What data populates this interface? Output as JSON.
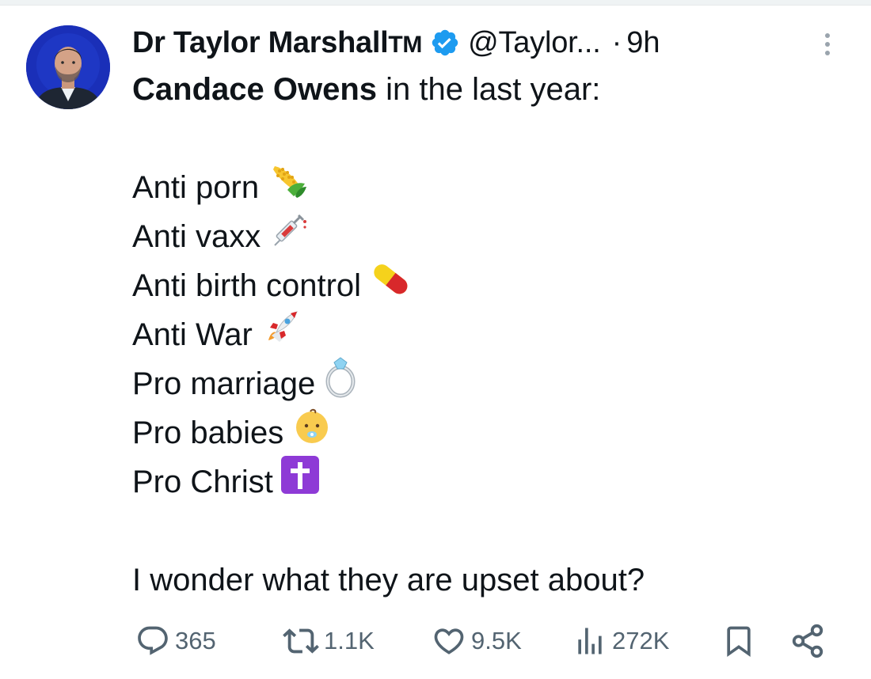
{
  "tweet": {
    "author": {
      "name": "Dr Taylor Marshall",
      "name_suffix": "TM",
      "handle": "@Taylor...",
      "verified_icon": "verified-badge-icon",
      "avatar_bg": "#1a2fb8"
    },
    "separator": "·",
    "time": "9h",
    "more_icon": "more-vertical-icon",
    "text": {
      "mention_bold": "Candace Owens",
      "first_line_rest": " in the last year:",
      "items": [
        {
          "label": "Anti porn",
          "emoji": "corn-icon"
        },
        {
          "label": "Anti vaxx",
          "emoji": "syringe-icon"
        },
        {
          "label": "Anti birth control",
          "emoji": "pill-icon"
        },
        {
          "label": "Anti War",
          "emoji": "rocket-icon"
        },
        {
          "label": "Pro marriage",
          "emoji": "ring-icon"
        },
        {
          "label": "Pro babies",
          "emoji": "baby-icon"
        },
        {
          "label": "Pro Christ",
          "emoji": "latin-cross-icon"
        }
      ],
      "closing": "I wonder what they are upset about?"
    },
    "actions": {
      "replies": "365",
      "reposts": "1.1K",
      "likes": "9.5K",
      "views": "272K"
    },
    "colors": {
      "text": "#0f1419",
      "muted": "#536471",
      "verified": "#1d9bf0"
    }
  }
}
